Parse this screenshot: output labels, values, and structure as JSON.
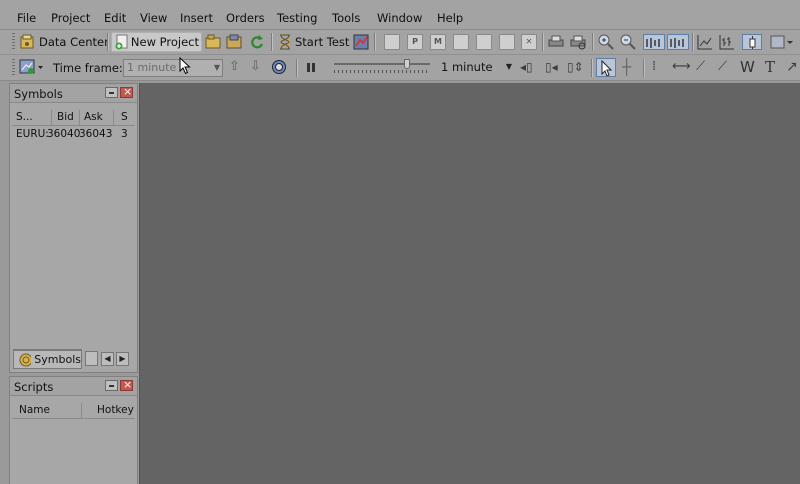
{
  "menu": [
    "File",
    "Project",
    "Edit",
    "View",
    "Insert",
    "Orders",
    "Testing",
    "Tools",
    "Window",
    "Help"
  ],
  "toolbar1": {
    "data_center_label": "Data Center",
    "new_project_label": "New Project",
    "start_test_label": "Start Test",
    "doc_icons": [
      "",
      "P",
      "M",
      "",
      "",
      "",
      "✕"
    ]
  },
  "toolbar2": {
    "time_frame_label": "Time frame:",
    "time_frame_value": "1 minute",
    "speed_value": "1 minute",
    "letter_tools": [
      "W",
      "T"
    ]
  },
  "symbols_panel": {
    "title": "Symbols",
    "columns": [
      "S...",
      "Bid",
      "Ask",
      "S"
    ],
    "rows": [
      {
        "symbol": "EURU:",
        "bid": "36040",
        "ask": "36043",
        "spread": "3"
      }
    ],
    "tab_label": "Symbols"
  },
  "scripts_panel": {
    "title": "Scripts",
    "columns": [
      "Name",
      "Hotkey"
    ]
  },
  "colors": {
    "workspace": "#646464",
    "chrome": "#a3a3a3",
    "close_button": "#c45850"
  }
}
